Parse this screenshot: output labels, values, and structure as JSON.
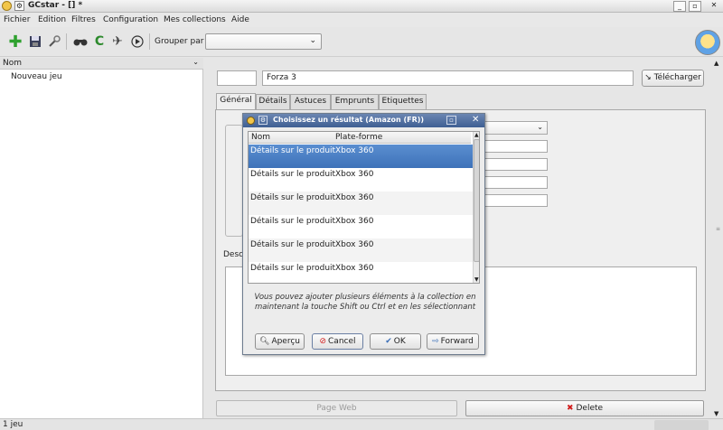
{
  "window": {
    "title": "GCstar - [] *"
  },
  "menu": [
    "Fichier",
    "Edition",
    "Filtres",
    "Configuration",
    "Mes collections",
    "Aide"
  ],
  "toolbar": {
    "group_label": "Grouper par",
    "group_value": ""
  },
  "icons": {
    "add": "plus-icon",
    "save": "floppy-icon",
    "prefs": "wrench-icon",
    "search": "binoculars-icon",
    "refresh": "refresh-icon",
    "random": "pin-icon",
    "play": "play-icon",
    "avatar": "avatar-icon"
  },
  "left_panel": {
    "header": "Nom",
    "items": [
      "Nouveau jeu"
    ]
  },
  "item": {
    "id": "",
    "name": "Forza 3",
    "download_label": "Télécharger"
  },
  "tabs": [
    "Général",
    "Détails",
    "Astuces",
    "Emprunts",
    "Etiquettes"
  ],
  "description_label": "Desc",
  "buttons": {
    "page_web": "Page Web",
    "delete": "Delete"
  },
  "status": "1 jeu",
  "dialog": {
    "title": "Choisissez un résultat (Amazon (FR))",
    "columns": [
      "Nom",
      "Plate-forme"
    ],
    "rows": [
      {
        "name": "Détails sur le produit",
        "platform": "Xbox 360"
      },
      {
        "name": "Détails sur le produit",
        "platform": "Xbox 360"
      },
      {
        "name": "Détails sur le produit",
        "platform": "Xbox 360"
      },
      {
        "name": "Détails sur le produit",
        "platform": "Xbox 360"
      },
      {
        "name": "Détails sur le produit",
        "platform": "Xbox 360"
      },
      {
        "name": "Détails sur le produit",
        "platform": "Xbox 360"
      }
    ],
    "note": "Vous pouvez ajouter plusieurs éléments à la collection en maintenant la touche Shift ou Ctrl et en les sélectionnant",
    "buttons": {
      "preview": "Aperçu",
      "cancel": "Cancel",
      "ok": "OK",
      "forward": "Forward"
    }
  },
  "colors": {
    "selection": "#3e72b9",
    "title_bar_dialog": "#4a6a9e",
    "delete_x": "#d21c1c",
    "add_green": "#2fa12f"
  }
}
